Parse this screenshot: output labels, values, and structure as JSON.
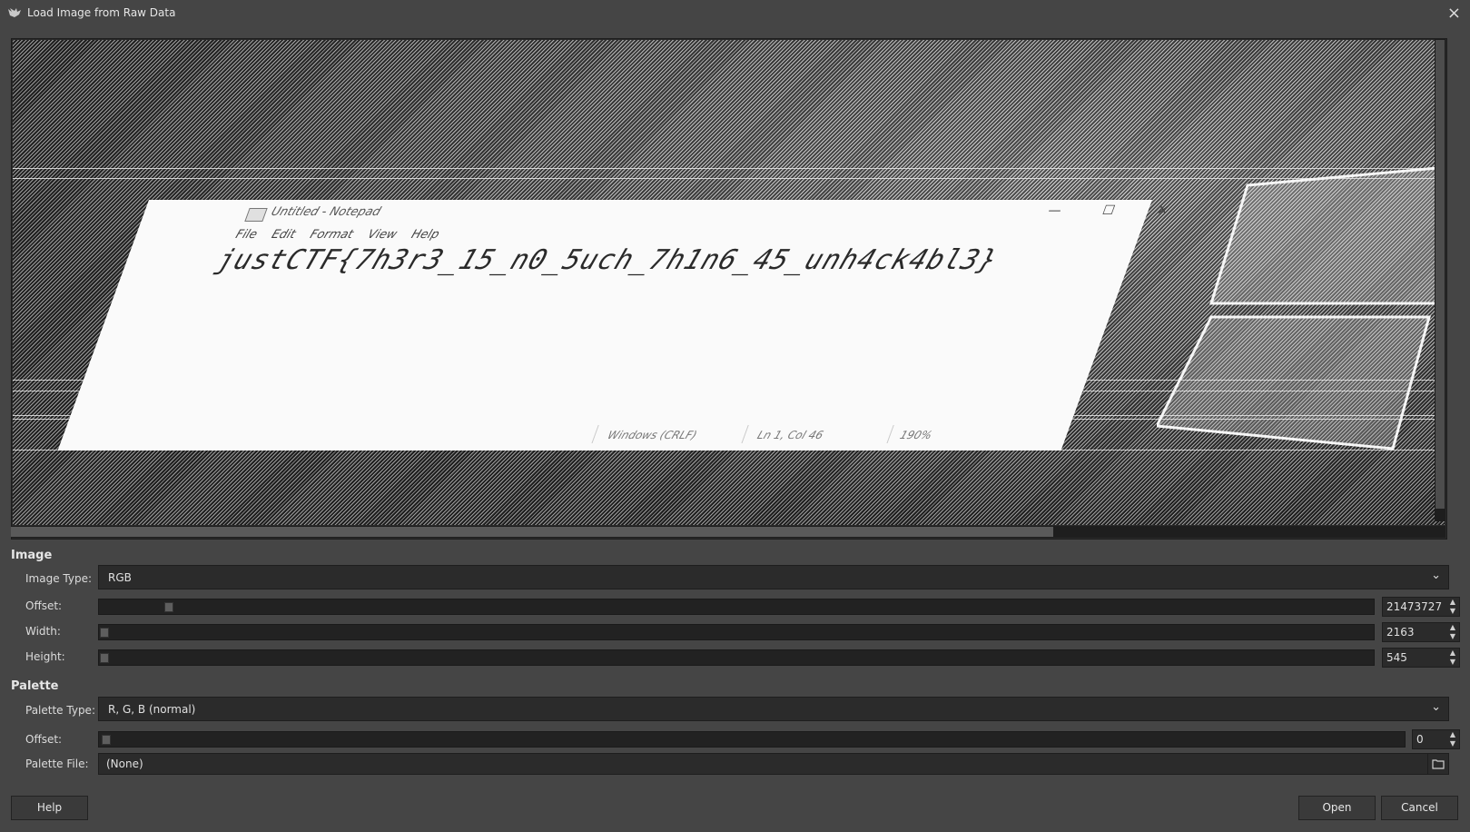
{
  "window": {
    "title": "Load Image from Raw Data",
    "close_icon": "×"
  },
  "preview": {
    "notepad": {
      "title": "Untitled - Notepad",
      "menu": [
        "File",
        "Edit",
        "Format",
        "View",
        "Help"
      ],
      "text": "justCTF{7h3r3_15_n0_5uch_7h1n6_45_unh4ck4bl3}",
      "status_eol": "Windows (CRLF)",
      "status_pos": "Ln 1, Col 46",
      "status_zoom": "190%",
      "minimize": "—",
      "maximize": "☐",
      "close": "✕"
    }
  },
  "image_section": {
    "title": "Image",
    "image_type_label": "Image Type:",
    "image_type_value": "RGB",
    "offset_label": "Offset:",
    "offset_value": "21473727",
    "width_label": "Width:",
    "width_value": "2163",
    "height_label": "Height:",
    "height_value": "545"
  },
  "palette_section": {
    "title": "Palette",
    "palette_type_label": "Palette Type:",
    "palette_type_value": "R, G, B (normal)",
    "offset_label": "Offset:",
    "offset_value": "0",
    "palette_file_label": "Palette File:",
    "palette_file_value": "(None)"
  },
  "buttons": {
    "help": "Help",
    "open": "Open",
    "cancel": "Cancel"
  }
}
